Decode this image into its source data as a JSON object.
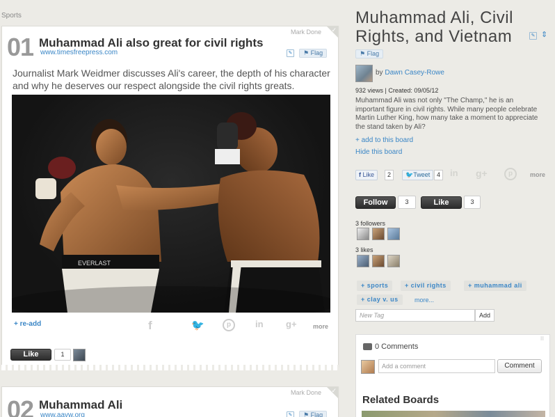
{
  "breadcrumb": "Sports",
  "links": [
    {
      "number": "01",
      "title": "Muhammad Ali also great for civil rights",
      "url": "www.timesfreepress.com",
      "mark_done": "Mark Done",
      "flag": "Flag",
      "description": "Journalist Mark Weidmer discusses Ali's career,  the depth of his character and why he deserves our respect alongside the civil rights greats.",
      "re_add": "+ re-add",
      "share_more": "more",
      "like_label": "Like",
      "like_count": "1"
    },
    {
      "number": "02",
      "title": "Muhammad Ali",
      "url": "www.aavw.org",
      "mark_done": "Mark Done",
      "flag": "Flag"
    }
  ],
  "board": {
    "title": "Muhammad Ali, Civil Rights, and Vietnam",
    "flag": "Flag",
    "by_prefix": "by",
    "author": "Dawn Casey-Rowe",
    "views_created": "932 views | Created: 09/05/12",
    "description": "Muhammad Ali was not only \"The Champ,\" he is an important figure in civil rights. While many people celebrate Martin Luther King, how many take a moment to appreciate the stand taken by Ali?",
    "add_to_board": "+ add to this board",
    "hide_board": "Hide this board",
    "fb_like": "Like",
    "fb_count": "2",
    "tweet": "Tweet",
    "tweet_count": "4",
    "share_more": "more",
    "follow_label": "Follow",
    "follow_count": "3",
    "like_label": "Like",
    "like_count": "3",
    "followers_label": "3 followers",
    "likes_label": "3 likes",
    "tags": [
      "+ sports",
      "+ civil rights",
      "+ muhammad ali",
      "+ clay v. us"
    ],
    "tags_more": "more...",
    "new_tag_placeholder": "New Tag",
    "add_tag_button": "Add"
  },
  "comments": {
    "count_label": "0 Comments",
    "input_placeholder": "Add a comment",
    "button": "Comment"
  },
  "related_heading": "Related Boards",
  "icons": {
    "facebook": "f",
    "twitter": "t",
    "pinterest": "p",
    "linkedin": "in",
    "googleplus": "g+"
  },
  "colors": {
    "link_blue": "#3a86c6",
    "page_bg": "#ecebe6",
    "button_dark": "#2c2c2c"
  }
}
